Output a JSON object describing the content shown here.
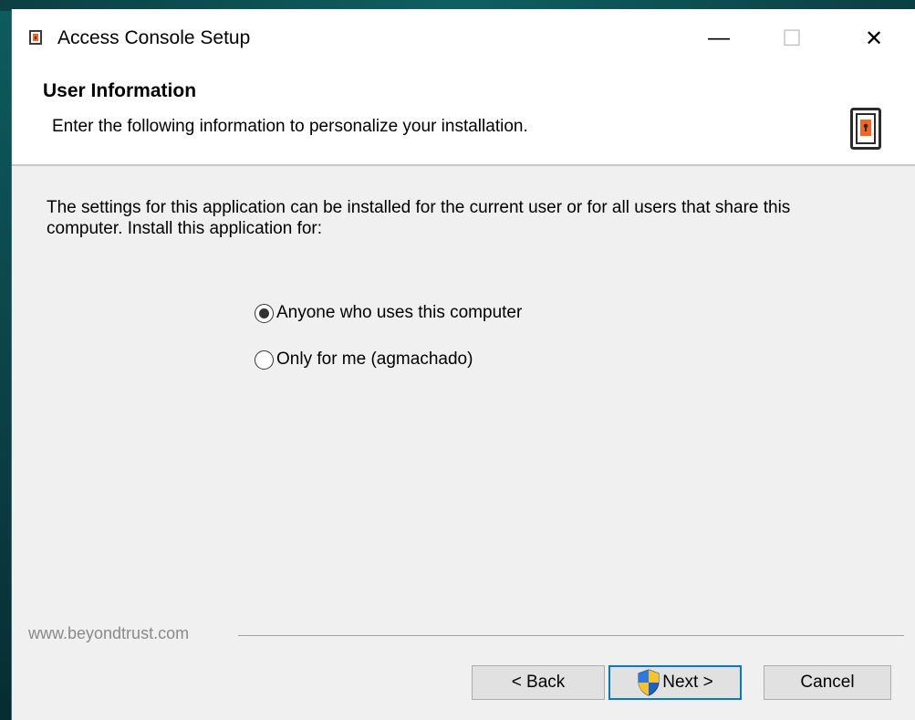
{
  "window": {
    "title": "Access Console Setup",
    "minimize_glyph": "—",
    "maximize_glyph": "☐",
    "close_glyph": "✕"
  },
  "header": {
    "title": "User Information",
    "subtitle": "Enter the following information to personalize your installation."
  },
  "body": {
    "description": "The settings for this application can be installed for the current user or for all users that share this computer. Install this application for:",
    "options": [
      {
        "label": "Anyone who uses this computer",
        "selected": true
      },
      {
        "label": "Only for me (agmachado)",
        "selected": false
      }
    ]
  },
  "footer": {
    "brand": "www.beyondtrust.com",
    "back_label": "< Back",
    "next_label": "Next >",
    "cancel_label": "Cancel"
  },
  "icons": {
    "app": "door-icon",
    "header": "door-icon",
    "next": "uac-shield-icon"
  },
  "colors": {
    "accent": "#0078d7",
    "brand_orange": "#f26522"
  }
}
